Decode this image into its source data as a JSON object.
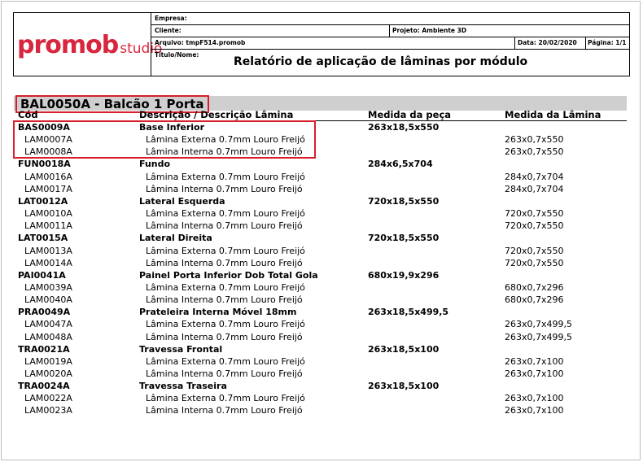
{
  "header": {
    "logo_main": "promob",
    "logo_sub": "studio",
    "empresa_label": "Empresa:",
    "cliente_label": "Cliente:",
    "projeto_label": "Projeto: Ambiente 3D",
    "arquivo_label": "Arquivo: tmpF514.promob",
    "data_label": "Data: 20/02/2020",
    "pagina_label": "Página: 1/1",
    "titulo_label": "Título/Nome:",
    "report_title": "Relatório de aplicação de lâminas por módulo"
  },
  "section": {
    "title": "BAL0050A - Balcão 1 Porta",
    "columns": [
      "Cód",
      "Descrição / Descrição Lâmina",
      "Medida da peça",
      "Medida da Lâmina"
    ]
  },
  "rows": [
    {
      "type": "part",
      "code": "BAS0009A",
      "desc": "Base Inferior",
      "piece": "263x18,5x550",
      "blade": ""
    },
    {
      "type": "blade",
      "code": "LAM0007A",
      "desc": "Lâmina Externa 0.7mm Louro Freijó",
      "piece": "",
      "blade": "263x0,7x550"
    },
    {
      "type": "blade",
      "code": "LAM0008A",
      "desc": "Lâmina Interna 0.7mm Louro Freijó",
      "piece": "",
      "blade": "263x0,7x550"
    },
    {
      "type": "part",
      "code": "FUN0018A",
      "desc": "Fundo",
      "piece": "284x6,5x704",
      "blade": ""
    },
    {
      "type": "blade",
      "code": "LAM0016A",
      "desc": "Lâmina Externa 0.7mm Louro Freijó",
      "piece": "",
      "blade": "284x0,7x704"
    },
    {
      "type": "blade",
      "code": "LAM0017A",
      "desc": "Lâmina Interna 0.7mm Louro Freijó",
      "piece": "",
      "blade": "284x0,7x704"
    },
    {
      "type": "part",
      "code": "LAT0012A",
      "desc": "Lateral Esquerda",
      "piece": "720x18,5x550",
      "blade": ""
    },
    {
      "type": "blade",
      "code": "LAM0010A",
      "desc": "Lâmina Externa 0.7mm Louro Freijó",
      "piece": "",
      "blade": "720x0,7x550"
    },
    {
      "type": "blade",
      "code": "LAM0011A",
      "desc": "Lâmina Interna 0.7mm Louro Freijó",
      "piece": "",
      "blade": "720x0,7x550"
    },
    {
      "type": "part",
      "code": "LAT0015A",
      "desc": "Lateral Direita",
      "piece": "720x18,5x550",
      "blade": ""
    },
    {
      "type": "blade",
      "code": "LAM0013A",
      "desc": "Lâmina Externa 0.7mm Louro Freijó",
      "piece": "",
      "blade": "720x0,7x550"
    },
    {
      "type": "blade",
      "code": "LAM0014A",
      "desc": "Lâmina Interna 0.7mm Louro Freijó",
      "piece": "",
      "blade": "720x0,7x550"
    },
    {
      "type": "part",
      "code": "PAI0041A",
      "desc": "Painel Porta Inferior Dob Total Gola",
      "piece": "680x19,9x296",
      "blade": ""
    },
    {
      "type": "blade",
      "code": "LAM0039A",
      "desc": "Lâmina Externa 0.7mm Louro Freijó",
      "piece": "",
      "blade": "680x0,7x296"
    },
    {
      "type": "blade",
      "code": "LAM0040A",
      "desc": "Lâmina Interna 0.7mm Louro Freijó",
      "piece": "",
      "blade": "680x0,7x296"
    },
    {
      "type": "part",
      "code": "PRA0049A",
      "desc": "Prateleira Interna Móvel 18mm",
      "piece": "263x18,5x499,5",
      "blade": ""
    },
    {
      "type": "blade",
      "code": "LAM0047A",
      "desc": "Lâmina Externa 0.7mm Louro Freijó",
      "piece": "",
      "blade": "263x0,7x499,5"
    },
    {
      "type": "blade",
      "code": "LAM0048A",
      "desc": "Lâmina Interna 0.7mm Louro Freijó",
      "piece": "",
      "blade": "263x0,7x499,5"
    },
    {
      "type": "part",
      "code": "TRA0021A",
      "desc": "Travessa Frontal",
      "piece": "263x18,5x100",
      "blade": ""
    },
    {
      "type": "blade",
      "code": "LAM0019A",
      "desc": "Lâmina Externa 0.7mm Louro Freijó",
      "piece": "",
      "blade": "263x0,7x100"
    },
    {
      "type": "blade",
      "code": "LAM0020A",
      "desc": "Lâmina Interna 0.7mm Louro Freijó",
      "piece": "",
      "blade": "263x0,7x100"
    },
    {
      "type": "part",
      "code": "TRA0024A",
      "desc": "Travessa Traseira",
      "piece": "263x18,5x100",
      "blade": ""
    },
    {
      "type": "blade",
      "code": "LAM0022A",
      "desc": "Lâmina Externa 0.7mm Louro Freijó",
      "piece": "",
      "blade": "263x0,7x100"
    },
    {
      "type": "blade",
      "code": "LAM0023A",
      "desc": "Lâmina Interna 0.7mm Louro Freijó",
      "piece": "",
      "blade": "263x0,7x100"
    }
  ],
  "colors": {
    "brand": "#d7263d",
    "highlight": "#d71f2b",
    "band": "#cfcfcf"
  }
}
